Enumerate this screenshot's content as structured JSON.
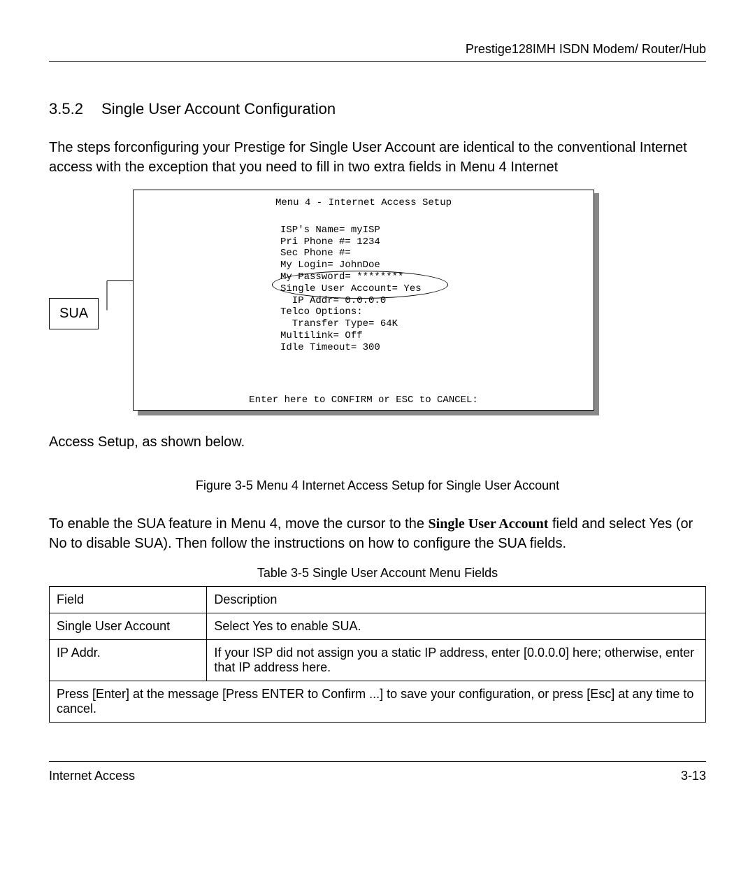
{
  "header": {
    "product": "Prestige128IMH ISDN Modem/ Router/Hub"
  },
  "section": {
    "number": "3.5.2",
    "title": "Single User Account Configuration"
  },
  "paragraph1_parts": {
    "a": "The steps for",
    "b": "configuring your Prestige for Single User Account are identical to the conventional Internet access with the exception that you need to fill in two extra fields in Menu 4",
    "c": "Internet"
  },
  "diagram": {
    "sua_label": "SUA",
    "terminal": {
      "title": "Menu 4 - Internet Access Setup",
      "fields": [
        "ISP's Name= myISP",
        "Pri Phone #= 1234",
        "Sec Phone #=",
        "My Login= JohnDoe",
        "My Password= ********",
        "Single User Account= Yes",
        "  IP Addr= 0.0.0.0",
        "Telco Options:",
        "  Transfer Type= 64K",
        "Multilink= Off",
        "Idle Timeout= 300"
      ],
      "confirm": "Enter here to CONFIRM or ESC to CANCEL:"
    }
  },
  "caption_below_box": "Access Setup, as shown below.",
  "figure_caption": "Figure  3-5 Menu 4    Internet Access Setup for Single User Account",
  "paragraph2_parts": {
    "a": "To enable the SUA feature in Menu 4, move the cursor to the",
    "b": "Single User Account",
    "c": " field and select",
    "d": "Yes (or",
    "e": "No to disable SUA). Then follow the instructions on how to configure the SUA fields."
  },
  "table_caption": "Table 3-5 Single User Account Menu Fields",
  "table": {
    "headers": [
      "Field",
      "Description"
    ],
    "rows": [
      [
        "Single User Account",
        "Select Yes to enable SUA."
      ],
      [
        " IP Addr.",
        "If your ISP did not assign you a static IP address, enter [0.0.0.0] here; otherwise, enter that IP address here."
      ]
    ],
    "footer": "Press [Enter] at the message [Press ENTER to Confirm ...] to save your configuration, or press [Esc] at any time to cancel."
  },
  "footer": {
    "left": "Internet Access",
    "right": "3-13"
  }
}
